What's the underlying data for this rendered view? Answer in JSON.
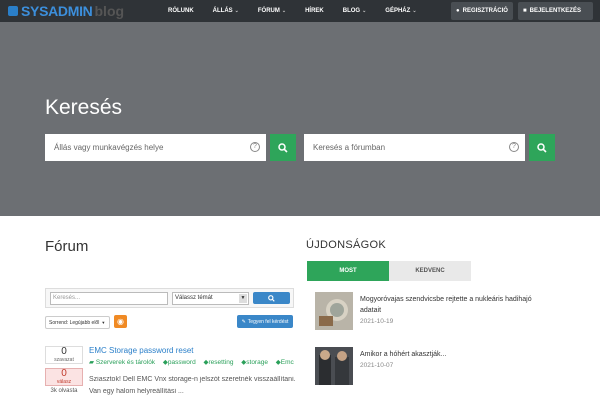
{
  "nav": {
    "logo_text": "SYSADMIN",
    "logo_sub": "blog",
    "items": [
      {
        "label": "RÓLUNK",
        "dropdown": false
      },
      {
        "label": "ÁLLÁS",
        "dropdown": true
      },
      {
        "label": "FÓRUM",
        "dropdown": true
      },
      {
        "label": "HÍREK",
        "dropdown": false
      },
      {
        "label": "BLOG",
        "dropdown": true
      },
      {
        "label": "GÉPHÁZ",
        "dropdown": true
      }
    ],
    "register": "REGISZTRÁCIÓ",
    "login": "BEJELENTKEZÉS"
  },
  "hero": {
    "title": "Keresés",
    "job_search_placeholder": "Állás vagy munkavégzés helye",
    "forum_search_placeholder": "Keresés a fórumban"
  },
  "forum": {
    "title": "Fórum",
    "filter_placeholder": "Keresés...",
    "topic_select": "Válassz témát",
    "sort_label": "Sorrend: Legújabb elől",
    "ask_button": "Tegyen fel kérdést",
    "topics": [
      {
        "title": "EMC Storage password reset",
        "votes": "0",
        "votes_label": "szavazat",
        "answers": "0",
        "answers_label": "válasz",
        "views": "3k olvasta",
        "tags": [
          "Szerverek és tárolók",
          "password",
          "resetting",
          "storage",
          "Emc"
        ],
        "excerpt_line1": "Sziasztok! Dell EMC Vnx storage-n jelszót szeretnék visszaállítani.",
        "excerpt_line2": "Van egy halom helyreállítási ..."
      }
    ]
  },
  "sidebar": {
    "title": "ÚJDONSÁGOK",
    "tab_new": "MOST",
    "tab_fav": "KEDVENC",
    "news": [
      {
        "title": "Mogyoróvajas szendvicsbe rejtette a nukleáris hadihajó adatait",
        "date": "2021-10-19"
      },
      {
        "title": "Amikor a hóhért akasztják...",
        "date": "2021-10-07"
      }
    ]
  },
  "colors": {
    "nav_bg": "#2f3337",
    "hero_bg": "#6c6f73",
    "accent_green": "#2ea55a",
    "link_blue": "#2a7fc9",
    "tag_green": "#2aa05a"
  }
}
